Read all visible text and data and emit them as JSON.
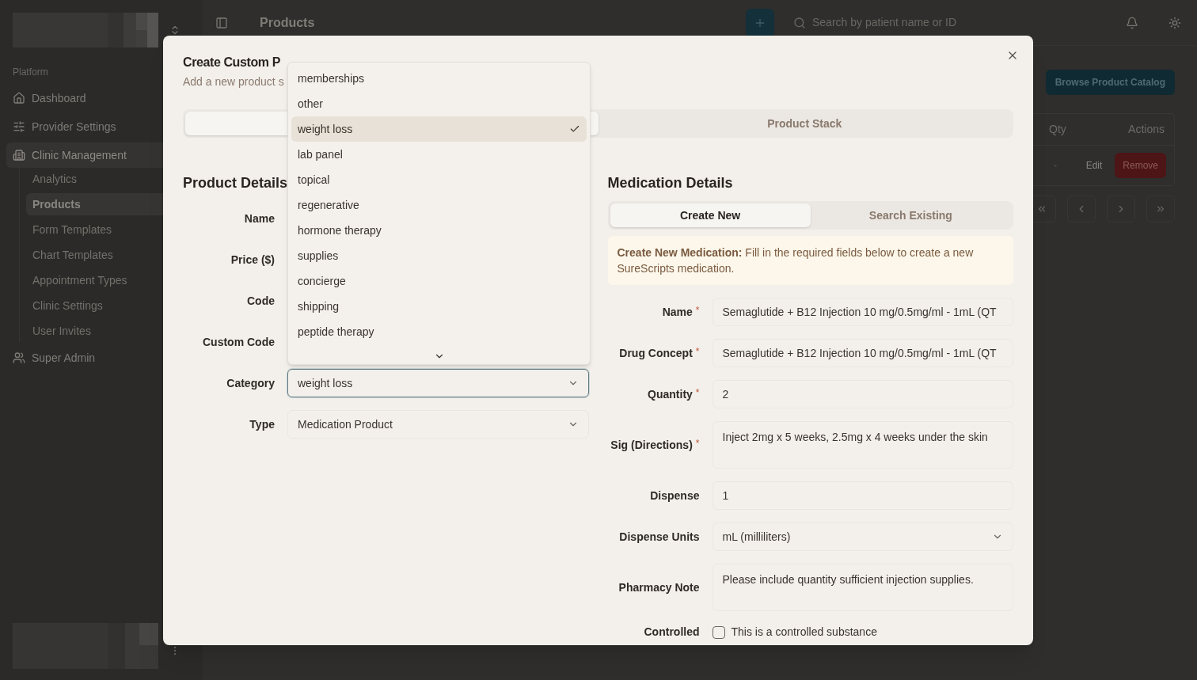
{
  "sidebar": {
    "section_label": "Platform",
    "items": [
      {
        "label": "Dashboard",
        "selected": false
      },
      {
        "label": "Provider Settings",
        "selected": false
      },
      {
        "label": "Clinic Management",
        "selected": true,
        "children": [
          {
            "label": "Analytics",
            "selected": false
          },
          {
            "label": "Products",
            "selected": true
          },
          {
            "label": "Form Templates",
            "selected": false
          },
          {
            "label": "Chart Templates",
            "selected": false
          },
          {
            "label": "Appointment Types",
            "selected": false
          },
          {
            "label": "Clinic Settings",
            "selected": false
          },
          {
            "label": "User Invites",
            "selected": false
          }
        ]
      },
      {
        "label": "Super Admin",
        "selected": false
      }
    ]
  },
  "header": {
    "title": "Products",
    "search": {
      "placeholder": "Search by patient name or ID"
    }
  },
  "page": {
    "catalog_button": "Browse Product Catalog",
    "table": {
      "columns": [
        "Qty",
        "Actions"
      ],
      "rows": [
        {
          "qty": "-",
          "actions": [
            "Edit",
            "Remove"
          ]
        }
      ]
    }
  },
  "dialog": {
    "title": "Create Custom P",
    "subtitle": "Add a new product s",
    "tabs": [
      {
        "selected": true
      },
      {
        "label": "Product Stack",
        "selected": false
      }
    ],
    "product_details": {
      "heading": "Product Details",
      "fields": [
        {
          "label": "Name"
        },
        {
          "label": "Price ($)"
        },
        {
          "label": "Code"
        },
        {
          "label": "Custom Code"
        },
        {
          "label": "Category",
          "value": "weight loss",
          "focused": true
        },
        {
          "label": "Type",
          "value": "Medication Product",
          "focused": false
        }
      ]
    },
    "category_dropdown": {
      "options": [
        {
          "label": "memberships",
          "selected": false
        },
        {
          "label": "other",
          "selected": false
        },
        {
          "label": "weight loss",
          "selected": true
        },
        {
          "label": "lab panel",
          "selected": false
        },
        {
          "label": "topical",
          "selected": false
        },
        {
          "label": "regenerative",
          "selected": false
        },
        {
          "label": "hormone therapy",
          "selected": false
        },
        {
          "label": "supplies",
          "selected": false
        },
        {
          "label": "concierge",
          "selected": false
        },
        {
          "label": "shipping",
          "selected": false
        },
        {
          "label": "peptide therapy",
          "selected": false
        }
      ]
    },
    "medication_details": {
      "heading": "Medication Details",
      "tabs": [
        {
          "label": "Create New",
          "selected": true
        },
        {
          "label": "Search Existing",
          "selected": false
        }
      ],
      "notice": "**Create New Medication:** Fill in the required fields below to create a new SureScripts medication.",
      "fields": [
        {
          "label": "Name",
          "required_mark": "*",
          "kind": "input",
          "value": "Semaglutide + B12 Injection 10 mg/0.5mg/ml - 1mL (QT"
        },
        {
          "label": "Drug Concept",
          "required_mark": "*",
          "kind": "input",
          "value": "Semaglutide + B12 Injection 10 mg/0.5mg/ml - 1mL (QT"
        },
        {
          "label": "Quantity",
          "required_mark": "*",
          "kind": "input",
          "value": "2"
        },
        {
          "label": "Sig (Directions)",
          "required_mark": "*",
          "kind": "textarea",
          "value": "Inject 2mg x 5 weeks, 2.5mg x 4 weeks under the skin"
        },
        {
          "label": "Dispense",
          "kind": "input",
          "value": "1"
        },
        {
          "label": "Dispense Units",
          "kind": "select",
          "value": "mL (milliliters)"
        },
        {
          "label": "Pharmacy Note",
          "kind": "textarea",
          "value": "Please include quantity sufficient injection supplies."
        },
        {
          "label": "Controlled",
          "kind": "checkbox",
          "checked": false,
          "text": "This is a controlled substance"
        }
      ]
    }
  }
}
